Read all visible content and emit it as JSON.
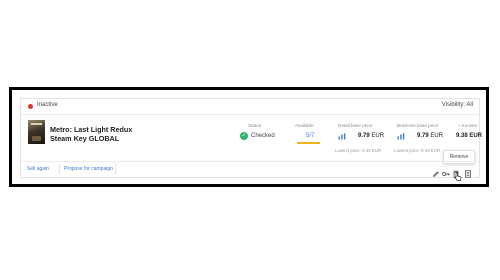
{
  "header": {
    "status": "Inactive",
    "visibility": "Visibility: All"
  },
  "product": {
    "title_line1": "Metro: Last Light Redux",
    "title_line2": "Steam Key GLOBAL"
  },
  "columns": {
    "status": "Status",
    "available": "Available",
    "retail": "Retail base price",
    "business": "Business base price",
    "income": "~ Income"
  },
  "values": {
    "status": "Checked",
    "available": "5/7",
    "retail_price": "9.79",
    "retail_currency": "EUR",
    "retail_lowest": "Lowest price: 9.40 EUR",
    "business_price": "9.79",
    "business_currency": "EUR",
    "business_lowest": "Lowest price: 9.49 EUR",
    "income": "9.38 EUR"
  },
  "footer": {
    "sell_again": "Sell again",
    "propose": "Propose for campaign"
  },
  "tooltip": {
    "remove": "Remove"
  },
  "colors": {
    "status_dot": "#e5322d",
    "checked": "#2fb36b",
    "link": "#3a7bd5",
    "availability_bar": "#f3b21c"
  },
  "icons": [
    "pencil-icon",
    "key-icon",
    "trash-icon",
    "document-icon",
    "cursor-hand-icon",
    "check-circle-icon",
    "strategy-icon"
  ]
}
